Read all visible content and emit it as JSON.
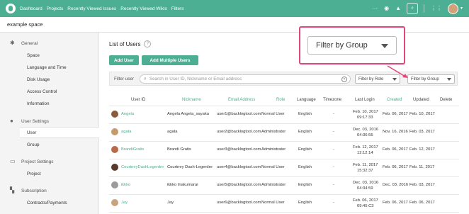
{
  "nav": {
    "items": [
      "Dashboard",
      "Projects",
      "Recently Viewed Issues",
      "Recently Viewed Wikis",
      "Filters"
    ],
    "more": "···",
    "eye_icon": "eye-icon",
    "bell_icon": "bell-icon"
  },
  "space": {
    "name": "example space"
  },
  "sidebar": {
    "general": "General",
    "general_items": [
      "Space",
      "Language and Time",
      "Disk Usage",
      "Access Control",
      "Information"
    ],
    "user_settings": "User Settings",
    "user_items": [
      "User",
      "Group"
    ],
    "project_settings": "Project Settings",
    "project_items": [
      "Project"
    ],
    "subscription": "Subscription",
    "subscription_items": [
      "Contracts/Payments"
    ]
  },
  "main": {
    "title": "List of Users",
    "help": "?",
    "add_user": "Add User",
    "add_multiple": "Add Multiple Users",
    "filter_label": "Filter user",
    "search_placeholder": "Search in User ID, Nickname or Email address",
    "filter_role": "Filter by Role",
    "filter_group": "Filter by Group"
  },
  "table": {
    "headers": [
      "User ID",
      "Nickname",
      "Email Address",
      "Role",
      "Language",
      "Timezone",
      "Last Login",
      "Created",
      "Updated",
      "Delete"
    ],
    "rows": [
      {
        "id": "Angela",
        "nick": "Angela Angela_sayaka",
        "email": "user1@backlogtool.com",
        "role": "Normal User",
        "lang": "English",
        "tz": "-",
        "login1": "Feb. 10, 2017",
        "login2": "09:17:33",
        "created": "Feb. 06, 2017",
        "updated": "Feb. 10, 2017"
      },
      {
        "id": "agata",
        "nick": "agata",
        "email": "user2@backlogtool.com",
        "role": "Administrator",
        "lang": "English",
        "tz": "-",
        "login1": "Dec. 03, 2016",
        "login2": "04:36:55",
        "created": "Nov. 16, 2016",
        "updated": "Feb. 03, 2017"
      },
      {
        "id": "BrandiGratis",
        "nick": "Brandi Gratis",
        "email": "user3@backlogtool.com",
        "role": "Administrator",
        "lang": "English",
        "tz": "-",
        "login1": "Feb. 12, 2017",
        "login2": "12:12:14",
        "created": "Feb. 06, 2017",
        "updated": "Feb. 12, 2017"
      },
      {
        "id": "CourtneyDashLegerdre",
        "nick": "Courtney Dash-Legerdre",
        "email": "user4@backlogtool.com",
        "role": "Normal User",
        "lang": "English",
        "tz": "-",
        "login1": "Feb. 11, 2017",
        "login2": "15:32:37",
        "created": "Feb. 06, 2017",
        "updated": "Feb. 11, 2017"
      },
      {
        "id": "ikkko",
        "nick": "ikkko Inakumarai",
        "email": "user5@backlogtool.com",
        "role": "Administrator",
        "lang": "English",
        "tz": "-",
        "login1": "Dec. 03, 2016",
        "login2": "04:34:59",
        "created": "Dec. 03, 2016",
        "updated": "Feb. 03, 2017"
      },
      {
        "id": "Jay",
        "nick": "Jay",
        "email": "user6@backlogtool.com",
        "role": "Normal User",
        "lang": "English",
        "tz": "-",
        "login1": "Feb. 06, 2017",
        "login2": "09:45:C3",
        "created": "Feb. 06, 2017",
        "updated": "Feb. 06, 2017"
      }
    ]
  },
  "callout": {
    "label": "Filter by Group"
  },
  "colors": {
    "brand": "#4caf93",
    "highlight": "#e0467c"
  }
}
